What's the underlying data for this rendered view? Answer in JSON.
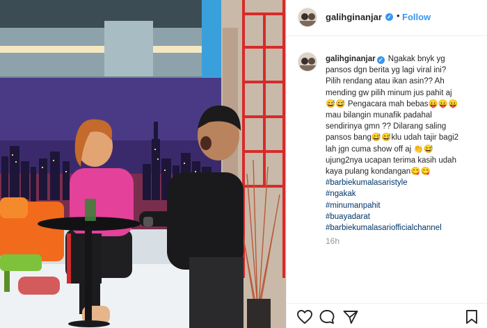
{
  "post": {
    "username": "galihginanjar",
    "follow_label": "Follow",
    "separator": "•",
    "verified_mark": "✓",
    "caption": {
      "username": "galihginanjar",
      "lines": [
        "Ngakak bnyk yg",
        "pansos dgn berita yg lagi viral ini?",
        "Pilih rendang atau ikan asin?? Ah",
        "mending gw pilih minum jus pahit aj",
        "😅😅 Pengacara mah bebas😛😛😛",
        "mau bilangin munafik padahal",
        "sendirinya gmn ?? Dilarang saling",
        "pansos bang😅😅klu udah tajir bagi2",
        "lah jgn cuma show off aj 👏😅",
        "ujung2nya ucapan terima kasih udah",
        "kaya pulang kondangan😋😋"
      ],
      "hashtags": [
        "#barbiekumalasaristyle",
        "#ngakak",
        "#minumanpahit",
        "#buayadarat",
        "#barbiekumalasariofficialchannel"
      ]
    },
    "timestamp": "16h"
  },
  "icons": {
    "like": "heart-icon",
    "comment": "comment-icon",
    "share": "share-icon",
    "save": "bookmark-icon",
    "verified": "verified-badge-icon"
  },
  "colors": {
    "accent": "#3897f0",
    "hashtag": "#003569",
    "text": "#262626",
    "muted": "#999999",
    "divider": "#efefef"
  }
}
